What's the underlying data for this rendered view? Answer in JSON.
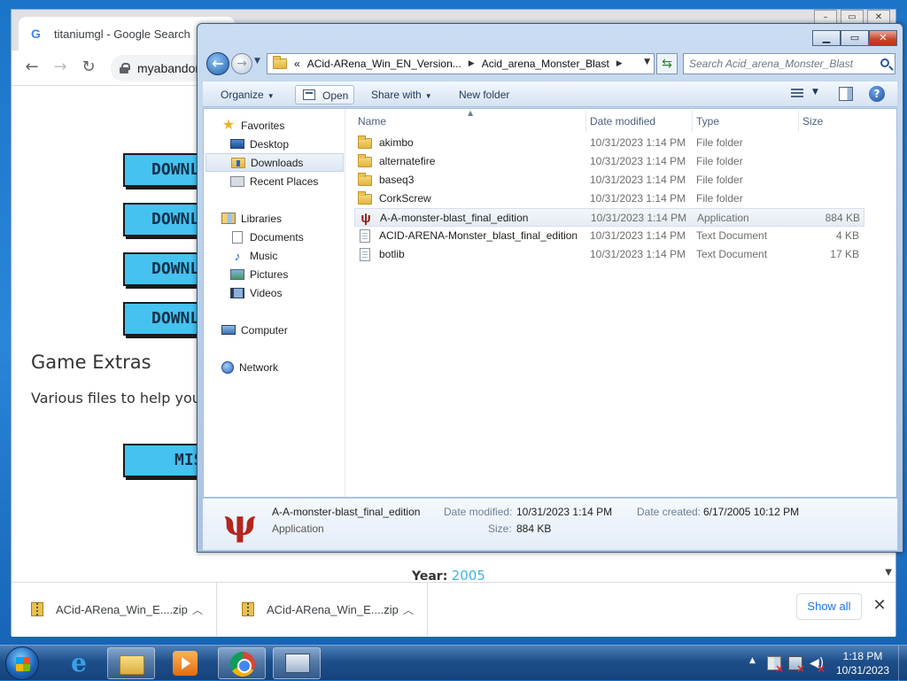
{
  "browser": {
    "tab_title": "titaniumgl - Google Search",
    "address_url": "myabandonware.com",
    "page": {
      "download_buttons": [
        "DOWNL",
        "DOWNL",
        "DOWNL",
        "DOWNL"
      ],
      "extras_title": "Game Extras",
      "extras_desc": "Various files to help you",
      "misc_button": "MIS",
      "year_label": "Year:",
      "year_value": "2005"
    },
    "downloads": [
      {
        "name": "ACid-ARena_Win_E....zip"
      },
      {
        "name": "ACid-ARena_Win_E....zip"
      }
    ],
    "show_all": "Show all"
  },
  "explorer": {
    "breadcrumb": {
      "prefix": "«",
      "segments": [
        "ACid-ARena_Win_EN_Version...",
        "Acid_arena_Monster_Blast"
      ]
    },
    "search_placeholder": "Search Acid_arena_Monster_Blast",
    "commands": {
      "organize": "Organize",
      "open": "Open",
      "share_with": "Share with",
      "new_folder": "New folder"
    },
    "nav": {
      "favorites": "Favorites",
      "desktop": "Desktop",
      "downloads": "Downloads",
      "recent_places": "Recent Places",
      "libraries": "Libraries",
      "documents": "Documents",
      "music": "Music",
      "pictures": "Pictures",
      "videos": "Videos",
      "computer": "Computer",
      "network": "Network"
    },
    "columns": {
      "name": "Name",
      "date_modified": "Date modified",
      "type": "Type",
      "size": "Size"
    },
    "files": [
      {
        "name": "akimbo",
        "date": "10/31/2023 1:14 PM",
        "type": "File folder",
        "size": "",
        "icon": "folder-icon"
      },
      {
        "name": "alternatefire",
        "date": "10/31/2023 1:14 PM",
        "type": "File folder",
        "size": "",
        "icon": "folder-icon"
      },
      {
        "name": "baseq3",
        "date": "10/31/2023 1:14 PM",
        "type": "File folder",
        "size": "",
        "icon": "folder-icon"
      },
      {
        "name": "CorkScrew",
        "date": "10/31/2023 1:14 PM",
        "type": "File folder",
        "size": "",
        "icon": "folder-icon"
      },
      {
        "name": "A-A-monster-blast_final_edition",
        "date": "10/31/2023 1:14 PM",
        "type": "Application",
        "size": "884 KB",
        "icon": "application-icon"
      },
      {
        "name": "ACID-ARENA-Monster_blast_final_edition",
        "date": "10/31/2023 1:14 PM",
        "type": "Text Document",
        "size": "4 KB",
        "icon": "text-document-icon"
      },
      {
        "name": "botlib",
        "date": "10/31/2023 1:14 PM",
        "type": "Text Document",
        "size": "17 KB",
        "icon": "text-document-icon"
      }
    ],
    "details": {
      "name": "A-A-monster-blast_final_edition",
      "type": "Application",
      "date_modified_label": "Date modified:",
      "date_modified": "10/31/2023 1:14 PM",
      "date_created_label": "Date created:",
      "date_created": "6/17/2005 10:12 PM",
      "size_label": "Size:",
      "size": "884 KB"
    }
  },
  "taskbar": {
    "time": "1:18 PM",
    "date": "10/31/2023"
  }
}
